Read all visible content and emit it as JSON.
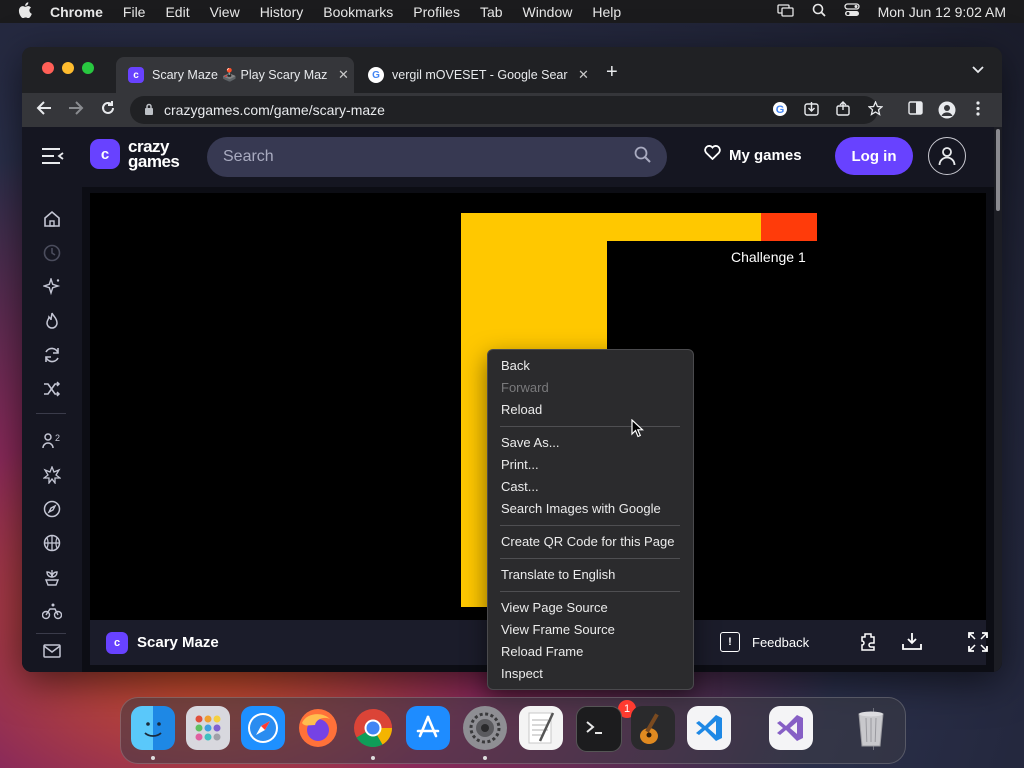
{
  "menubar": {
    "apple": "",
    "app": "Chrome",
    "items": [
      "File",
      "Edit",
      "View",
      "History",
      "Bookmarks",
      "Profiles",
      "Tab",
      "Window",
      "Help"
    ],
    "datetime": "Mon Jun 12  9:02 AM"
  },
  "tabs": [
    {
      "title": "Scary Maze 🕹️ Play Scary Maz",
      "favicon": "crazygames-icon",
      "active": true
    },
    {
      "title": "vergil mOVESET - Google Sear",
      "favicon": "google-icon",
      "active": false
    }
  ],
  "address": {
    "url": "crazygames.com/game/scary-maze"
  },
  "site": {
    "logo_line1": "crazy",
    "logo_line2": "games",
    "search_placeholder": "Search",
    "mygames_label": "My games",
    "login_label": "Log in"
  },
  "game": {
    "challenge_label": "Challenge 1",
    "name": "Scary Maze",
    "feedback_label": "Feedback"
  },
  "context_menu": [
    {
      "label": "Back",
      "disabled": false
    },
    {
      "label": "Forward",
      "disabled": true
    },
    {
      "label": "Reload",
      "disabled": false
    },
    {
      "label": "Save As...",
      "disabled": false
    },
    {
      "label": "Print...",
      "disabled": false
    },
    {
      "label": "Cast...",
      "disabled": false
    },
    {
      "label": "Search Images with Google",
      "disabled": false
    },
    {
      "label": "Create QR Code for this Page",
      "disabled": false
    },
    {
      "label": "Translate to English",
      "disabled": false
    },
    {
      "label": "View Page Source",
      "disabled": false
    },
    {
      "label": "View Frame Source",
      "disabled": false
    },
    {
      "label": "Reload Frame",
      "disabled": false
    },
    {
      "label": "Inspect",
      "disabled": false
    }
  ],
  "dock": {
    "apps": [
      "finder-icon",
      "launchpad-icon",
      "safari-icon",
      "firefox-icon",
      "chrome-icon",
      "app-store-icon",
      "system-settings-icon",
      "textedit-icon",
      "terminal-icon",
      "garageband-icon",
      "vscode-icon",
      "visual-studio-icon",
      "trash-icon"
    ],
    "settings_badge": "1"
  },
  "colors": {
    "brand": "#6842ff",
    "maze_path": "#ffc800",
    "maze_goal": "#ff3b0a"
  }
}
